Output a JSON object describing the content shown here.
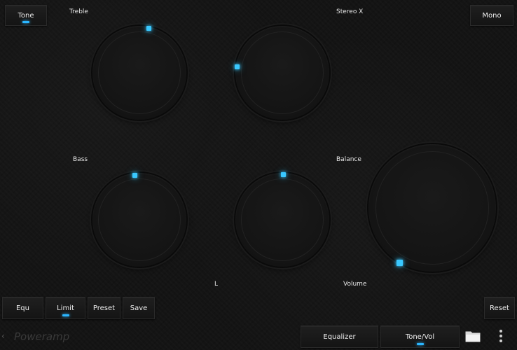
{
  "top": {
    "tone_label": "Tone",
    "mono_label": "Mono"
  },
  "knobs": {
    "treble_label": "Treble",
    "stereo_label": "Stereo X",
    "bass_label": "Bass",
    "balance_label": "Balance",
    "balance_l": "L",
    "volume_label": "Volume"
  },
  "buttons": {
    "equ": "Equ",
    "limit": "Limit",
    "preset": "Preset",
    "save": "Save",
    "reset": "Reset"
  },
  "nav": {
    "brand": "Poweramp",
    "back": "‹",
    "equalizer": "Equalizer",
    "tone_vol": "Tone/Vol"
  },
  "colors": {
    "accent": "#39c8ff"
  },
  "icons": {
    "folder": "folder-icon",
    "menu": "more-vertical-icon"
  }
}
